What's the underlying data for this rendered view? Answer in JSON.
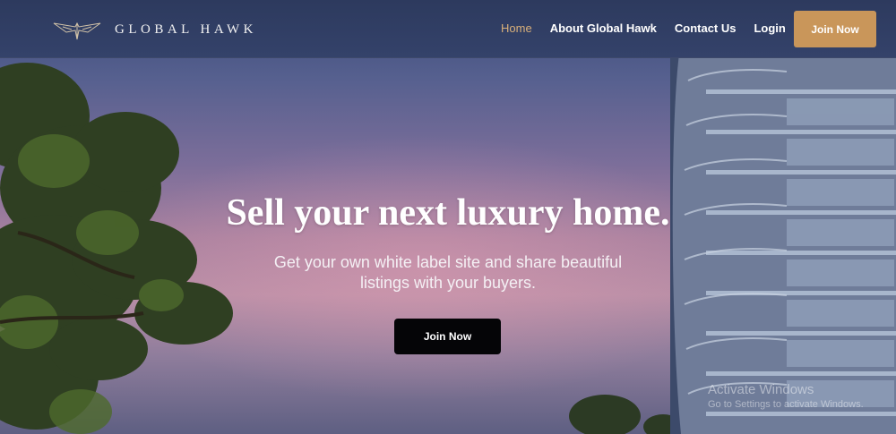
{
  "brand": {
    "name": "GLOBAL HAWK",
    "logo_icon": "hawk-logo-icon"
  },
  "nav": {
    "links": [
      {
        "label": "Home",
        "active": true
      },
      {
        "label": "About Global Hawk",
        "active": false
      },
      {
        "label": "Contact Us",
        "active": false
      },
      {
        "label": "Login",
        "active": false
      }
    ],
    "join_label": "Join Now"
  },
  "hero": {
    "headline": "Sell your next luxury home.",
    "subline": "Get your own white label site and share beautiful listings with your buyers.",
    "cta_label": "Join Now"
  },
  "watermark": {
    "title": "Activate Windows",
    "subtitle": "Go to Settings to activate Windows."
  },
  "colors": {
    "accent": "#c9965a",
    "nav_active": "#d9b07a",
    "navbar_bg": "#2d3a5e",
    "cta_bg": "#050507"
  }
}
